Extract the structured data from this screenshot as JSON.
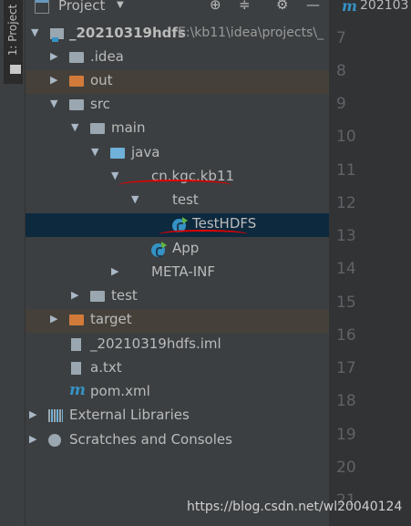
{
  "sidebar": {
    "tab_label": "1: Project"
  },
  "header": {
    "title": "Project"
  },
  "editor": {
    "tab_title": "202103",
    "line_numbers": [
      "7",
      "8",
      "9",
      "10",
      "11",
      "12",
      "13",
      "14",
      "15",
      "16",
      "17",
      "18",
      "19",
      "20",
      "21"
    ]
  },
  "tree": {
    "root": {
      "name": "_20210319hdfs",
      "path": "E:\\kb11\\idea\\projects\\_"
    },
    "idea": ".idea",
    "out": "out",
    "src": "src",
    "main": "main",
    "java": "java",
    "package": "cn.kgc.kb11",
    "test_pkg": "test",
    "selected_class": "TestHDFS",
    "app_class": "App",
    "meta_inf": "META-INF",
    "test_dir": "test",
    "target": "target",
    "iml": "_20210319hdfs.iml",
    "txt": "a.txt",
    "pom": "pom.xml",
    "external_libs": "External Libraries",
    "scratches": "Scratches and Consoles"
  },
  "watermark": "https://blog.csdn.net/wl20040124",
  "colors": {
    "selection": "#0d293e",
    "excluded": "#45413a",
    "annotation": "#e00000"
  }
}
